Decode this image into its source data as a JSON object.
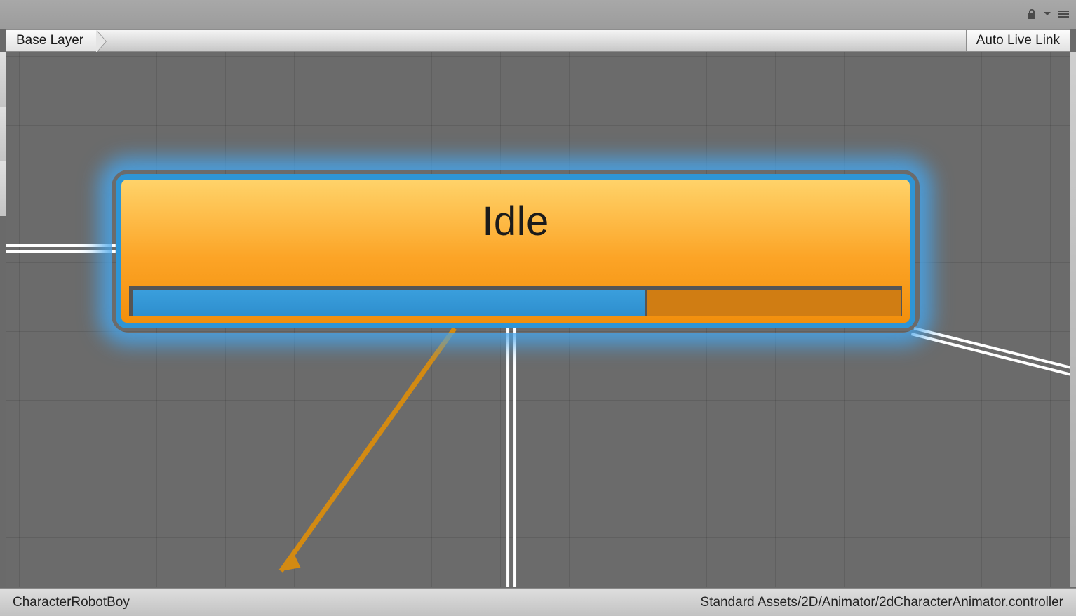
{
  "toolbar": {
    "lock_icon": "lock-icon",
    "dropdown_icon": "dropdown-icon",
    "list_icon": "context-menu-icon"
  },
  "breadcrumb": {
    "layer_label": "Base Layer",
    "autolive_label": "Auto Live Link"
  },
  "node": {
    "title": "Idle",
    "progress_percent": 67,
    "colors": {
      "selection_border": "#2e95d6",
      "fill_top": "#ffd36a",
      "fill_bottom": "#f28f0c",
      "progress_fill": "#3a9edc",
      "progress_track": "#d07d13"
    }
  },
  "statusbar": {
    "left_text": "CharacterRobotBoy",
    "right_text": "Standard Assets/2D/Animator/2dCharacterAnimator.controller"
  }
}
